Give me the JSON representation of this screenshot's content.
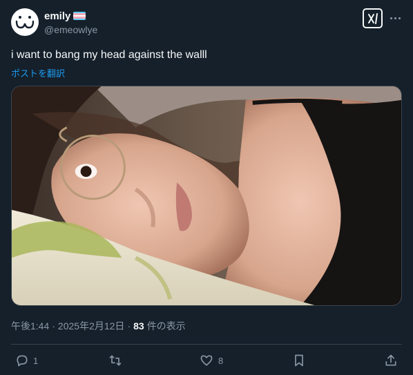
{
  "user": {
    "display_name": "emily",
    "handle": "@emeowlye",
    "flag_icon": "transgender-flag-icon",
    "flag_colors": [
      "#5bcefa",
      "#f5a9b8",
      "#ffffff",
      "#f5a9b8",
      "#5bcefa"
    ]
  },
  "tweet": {
    "text": "i want to bang my head against the walll",
    "translate_label": "ポストを翻訳"
  },
  "meta": {
    "time": "午後1:44",
    "separator1": "·",
    "date": "2025年2月12日",
    "separator2": "·",
    "views_count": "83",
    "views_label": "件の表示"
  },
  "actions": {
    "reply_count": "1",
    "retweet_count": "",
    "like_count": "8"
  },
  "colors": {
    "background": "#15202b",
    "text": "#f7f9f9",
    "secondary": "#8b98a5",
    "link": "#1d9bf0",
    "border": "#38444d"
  }
}
